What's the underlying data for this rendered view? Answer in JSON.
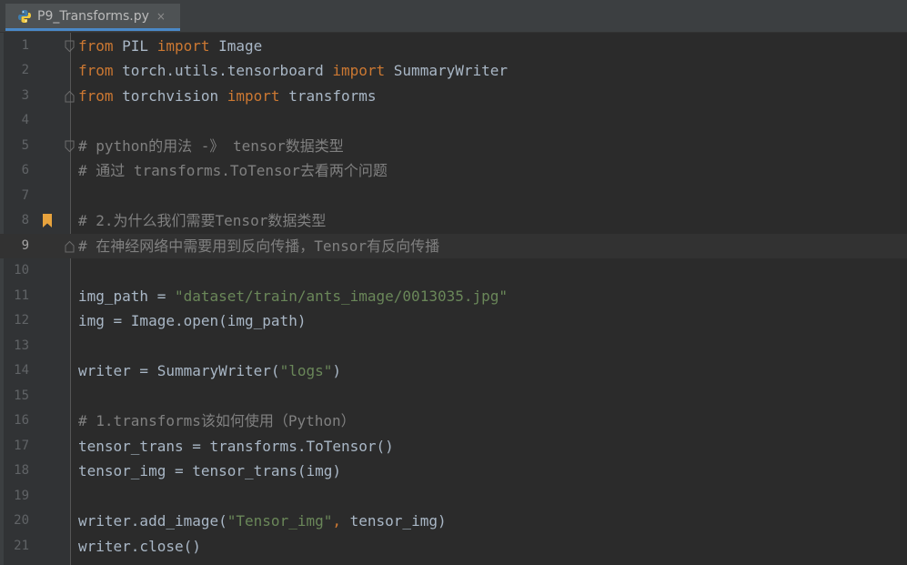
{
  "tab": {
    "label": "P9_Transforms.py",
    "close": "×",
    "icon": "python-file-icon"
  },
  "colors": {
    "keyword": "#cc7832",
    "string": "#6a8759",
    "comment": "#808080",
    "identifier": "#a9b7c6",
    "background": "#2b2b2b"
  },
  "editor": {
    "current_line": 9,
    "bookmark_line": 8,
    "lines": [
      {
        "num": "1",
        "segs": [
          [
            "kw",
            "from"
          ],
          [
            "id",
            " PIL "
          ],
          [
            "kw",
            "import"
          ],
          [
            "id",
            " Image"
          ]
        ]
      },
      {
        "num": "2",
        "segs": [
          [
            "kw",
            "from"
          ],
          [
            "id",
            " torch.utils.tensorboard "
          ],
          [
            "kw",
            "import"
          ],
          [
            "id",
            " SummaryWriter"
          ]
        ]
      },
      {
        "num": "3",
        "segs": [
          [
            "kw",
            "from"
          ],
          [
            "id",
            " torchvision "
          ],
          [
            "kw",
            "import"
          ],
          [
            "id",
            " transforms"
          ]
        ]
      },
      {
        "num": "4",
        "segs": []
      },
      {
        "num": "5",
        "segs": [
          [
            "cmt",
            "# python的用法 -》 tensor数据类型"
          ]
        ]
      },
      {
        "num": "6",
        "segs": [
          [
            "cmt",
            "# 通过 transforms.ToTensor去看两个问题"
          ]
        ]
      },
      {
        "num": "7",
        "segs": []
      },
      {
        "num": "8",
        "segs": [
          [
            "cmt",
            "# 2.为什么我们需要Tensor数据类型"
          ]
        ]
      },
      {
        "num": "9",
        "segs": [
          [
            "cmt",
            "# 在神经网络中需要用到反向传播，Tensor有反向传播"
          ]
        ]
      },
      {
        "num": "10",
        "segs": []
      },
      {
        "num": "11",
        "segs": [
          [
            "id",
            "img_path = "
          ],
          [
            "str",
            "\"dataset/train/ants_image/0013035.jpg\""
          ]
        ]
      },
      {
        "num": "12",
        "segs": [
          [
            "id",
            "img = Image.open(img_path)"
          ]
        ]
      },
      {
        "num": "13",
        "segs": []
      },
      {
        "num": "14",
        "segs": [
          [
            "id",
            "writer = SummaryWriter("
          ],
          [
            "str",
            "\"logs\""
          ],
          [
            "id",
            ")"
          ]
        ]
      },
      {
        "num": "15",
        "segs": []
      },
      {
        "num": "16",
        "segs": [
          [
            "cmt",
            "# 1.transforms该如何使用（Python）"
          ]
        ]
      },
      {
        "num": "17",
        "segs": [
          [
            "id",
            "tensor_trans = transforms.ToTensor()"
          ]
        ]
      },
      {
        "num": "18",
        "segs": [
          [
            "id",
            "tensor_img = tensor_trans(img)"
          ]
        ]
      },
      {
        "num": "19",
        "segs": []
      },
      {
        "num": "20",
        "segs": [
          [
            "id",
            "writer.add_image("
          ],
          [
            "str",
            "\"Tensor_img\""
          ],
          [
            "kw",
            ","
          ],
          [
            "id",
            " tensor_img)"
          ]
        ]
      },
      {
        "num": "21",
        "segs": [
          [
            "id",
            "writer.close()"
          ]
        ]
      }
    ]
  }
}
